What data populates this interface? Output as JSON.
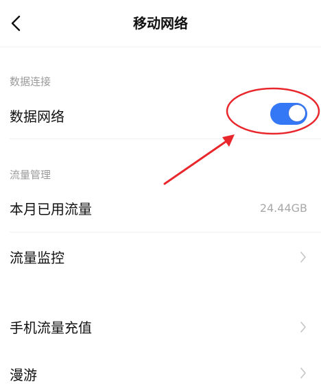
{
  "header": {
    "title": "移动网络",
    "back_icon": "chevron-left-icon"
  },
  "data_connection": {
    "section_label": "数据连接",
    "data_network_label": "数据网络",
    "data_network_enabled": true
  },
  "traffic": {
    "section_label": "流量管理",
    "used_label": "本月已用流量",
    "used_value": "24.44GB",
    "monitor_label": "流量监控"
  },
  "recharge_label": "手机流量充值",
  "roaming_label": "漫游",
  "colors": {
    "toggle_on": "#3478f6",
    "annotation": "#e8262b"
  }
}
